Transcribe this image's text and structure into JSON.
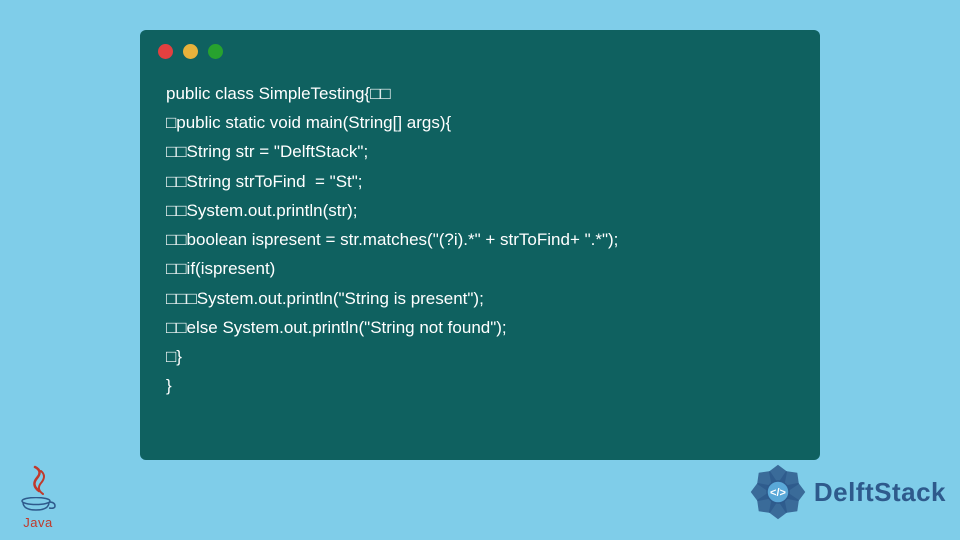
{
  "code": {
    "lines": [
      "public class SimpleTesting{□□",
      "□public static void main(String[] args){",
      "□□String str = \"DelftStack\";",
      "□□String strToFind  = \"St\";",
      "□□System.out.println(str);",
      "□□boolean ispresent = str.matches(\"(?i).*\" + strToFind+ \".*\");",
      "□□if(ispresent)",
      "□□□System.out.println(\"String is present\");",
      "□□else System.out.println(\"String not found\");",
      "□}",
      "}"
    ]
  },
  "logos": {
    "java_label": "Java",
    "delftstack_label": "DelftStack"
  },
  "colors": {
    "bg": "#7fcde9",
    "window": "#0f6160",
    "dot_red": "#e24040",
    "dot_yellow": "#e8b23b",
    "dot_green": "#27a22e",
    "delft_blue": "#2e5a8c",
    "java_red": "#c0392b"
  }
}
